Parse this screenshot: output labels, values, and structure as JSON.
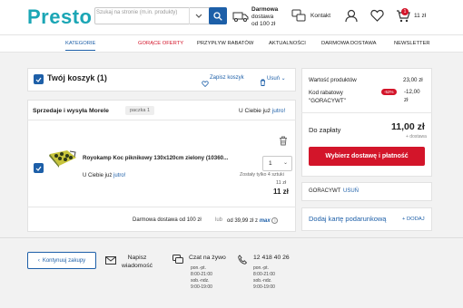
{
  "header": {
    "logo": "Presto",
    "search_placeholder": "Szukaj na stronie (m.in. produkty)",
    "delivery_line1": "Darmowa",
    "delivery_line2": "dostawa",
    "delivery_line3": "od 100 zł",
    "contact_label": "Kontakt",
    "cart_badge": "1",
    "cart_total": "11 zł"
  },
  "nav": {
    "items": [
      "KATEGORIE",
      "GORĄCE OFERTY",
      "PRZYPŁYW RABATÓW",
      "AKTUALNOŚCI",
      "DARMOWA DOSTAWA",
      "NEWSLETTER"
    ]
  },
  "cart": {
    "title": "Twój koszyk (1)",
    "save_label": "Zapisz koszyk",
    "remove_label": "Usuń",
    "seller_label": "Sprzedaje i wysyła Morele",
    "seller_tag": "paczka 1",
    "seller_delivery_prefix": "U Ciebie już",
    "seller_delivery_day": "jutro!",
    "product": {
      "name": "Royokamp Koc piknikowy 130x120cm zielony (10360...",
      "delivery_prefix": "U Ciebie już",
      "delivery_day": "jutro!",
      "quantity": "1",
      "stock_note": "Zostały tylko 4 sztuki",
      "unit_price": "11 zł",
      "total_price": "11 zł"
    },
    "free_shipping": "Darmowa dostawa od 100 zł",
    "or": "lub",
    "max_prefix": "od 39,99 zł z",
    "max_logo": "max"
  },
  "summary": {
    "products_label": "Wartość produktów",
    "products_value": "23,00 zł",
    "discount_label": "Kod rabatowy",
    "discount_code": "\"GORACYWT\"",
    "discount_badge": "-52%",
    "discount_value": "-12,00",
    "discount_unit": "zł",
    "total_label": "Do zapłaty",
    "total_value": "11,00 zł",
    "vat_note": "+ dostawa",
    "cta": "Wybierz dostawę i płatność",
    "code_name": "GORACYWT",
    "code_remove": "USUŃ",
    "gift_label": "Dodaj kartę podarunkową",
    "gift_add": "+ DODAJ"
  },
  "footer": {
    "continue": "Kontynuuj zakupy",
    "write_1": "Napisz",
    "write_2": "wiadomość",
    "chat_title": "Czat na żywo",
    "chat_h1": "pon.-pt.",
    "chat_h2": "8:00-21:00",
    "chat_h3": "sob.-ndz.",
    "chat_h4": "9:00-19:00",
    "phone_title": "12 418 40 26",
    "phone_h1": "pon.-pt.",
    "phone_h2": "8:00-21:00",
    "phone_h3": "sob.-ndz.",
    "phone_h4": "9:00-19:00"
  },
  "colors": {
    "brand": "#1ba6b5",
    "accent_blue": "#1d5fa8",
    "cta_red": "#d3152a"
  },
  "icons": [
    "search-icon",
    "chevron-down-icon",
    "truck-icon",
    "contact-icon",
    "user-icon",
    "heart-icon",
    "cart-icon",
    "checkbox-icon",
    "heart-outline-icon",
    "trash-icon",
    "mail-icon",
    "chat-icon",
    "phone-icon"
  ]
}
